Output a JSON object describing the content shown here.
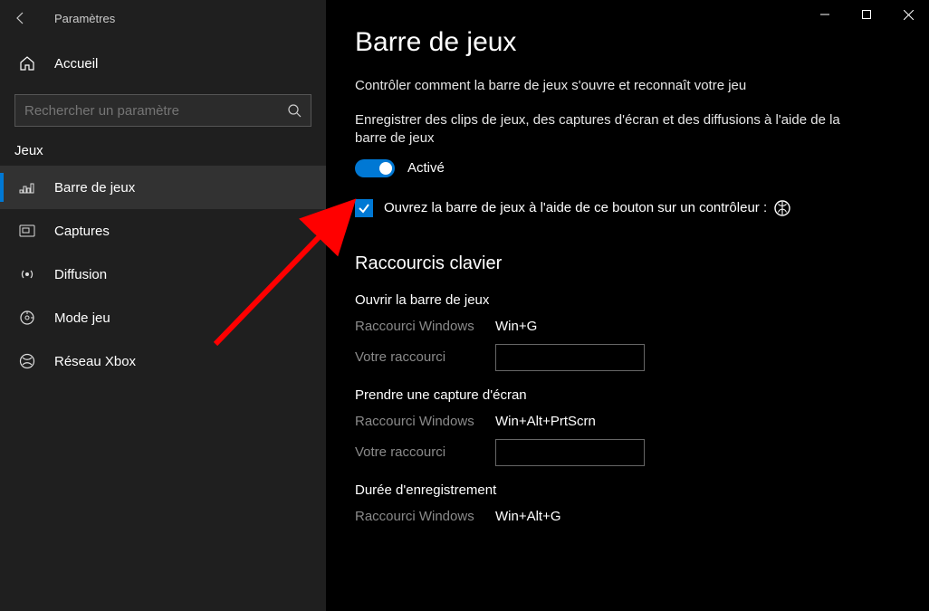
{
  "window": {
    "title": "Paramètres"
  },
  "sidebar": {
    "home_label": "Accueil",
    "search_placeholder": "Rechercher un paramètre",
    "category": "Jeux",
    "items": [
      {
        "label": "Barre de jeux",
        "icon": "game-bar-icon",
        "active": true
      },
      {
        "label": "Captures",
        "icon": "captures-icon"
      },
      {
        "label": "Diffusion",
        "icon": "broadcast-icon"
      },
      {
        "label": "Mode jeu",
        "icon": "game-mode-icon"
      },
      {
        "label": "Réseau Xbox",
        "icon": "xbox-network-icon"
      }
    ]
  },
  "main": {
    "title": "Barre de jeux",
    "description": "Contrôler comment la barre de jeux s'ouvre et reconnaît votre jeu",
    "toggle_desc": "Enregistrer des clips de jeux, des captures d'écran et des diffusions à l'aide de la barre de jeux",
    "toggle_state_label": "Activé",
    "checkbox_label": "Ouvrez la barre de jeux à l'aide de ce bouton sur un contrôleur :",
    "shortcuts_title": "Raccourcis clavier",
    "shortcut_win_label": "Raccourci Windows",
    "shortcut_user_label": "Votre raccourci",
    "shortcuts": [
      {
        "name": "Ouvrir la barre de jeux",
        "windows": "Win+G",
        "user": ""
      },
      {
        "name": "Prendre une capture d'écran",
        "windows": "Win+Alt+PrtScrn",
        "user": ""
      },
      {
        "name": "Durée d'enregistrement",
        "windows": "Win+Alt+G",
        "user": ""
      }
    ]
  }
}
